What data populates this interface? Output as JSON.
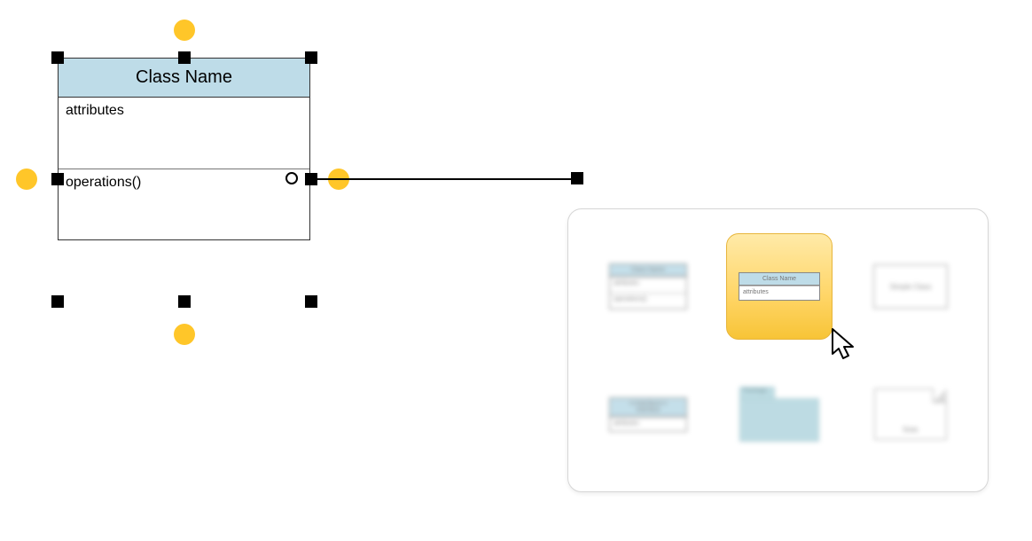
{
  "canvas": {
    "uml_class": {
      "title": "Class Name",
      "attributes_label": "attributes",
      "operations_label": "operations()"
    },
    "connection_points": [
      "top",
      "right",
      "bottom",
      "left"
    ],
    "selection_handles": [
      "nw",
      "n",
      "ne",
      "w",
      "e",
      "sw",
      "s",
      "se"
    ],
    "connector": {
      "start_shape": "uml_class",
      "end_handle": true
    }
  },
  "shape_picker": {
    "visible": true,
    "selected_index": 1,
    "options": [
      {
        "id": "class-3-section",
        "type": "uml-class",
        "title": "Class Name",
        "sections": [
          "attributes",
          "operations()"
        ]
      },
      {
        "id": "class-2-section",
        "type": "uml-class",
        "title": "Class Name",
        "sections": [
          "attributes"
        ]
      },
      {
        "id": "simple-class",
        "type": "rect",
        "label": "Simple Class"
      },
      {
        "id": "interface",
        "type": "uml-class",
        "title": "<<Interface>>\nInterface",
        "sections": [
          "attributes"
        ]
      },
      {
        "id": "package",
        "type": "package",
        "label": "Package"
      },
      {
        "id": "note",
        "type": "note",
        "label": "Note"
      }
    ]
  },
  "colors": {
    "class_header": "#bedce8",
    "connection_dot": "#ffc629",
    "highlight_border": "#e7b53b",
    "highlight_fill_top": "#ffeaa8",
    "highlight_fill_bottom": "#f7c437"
  }
}
